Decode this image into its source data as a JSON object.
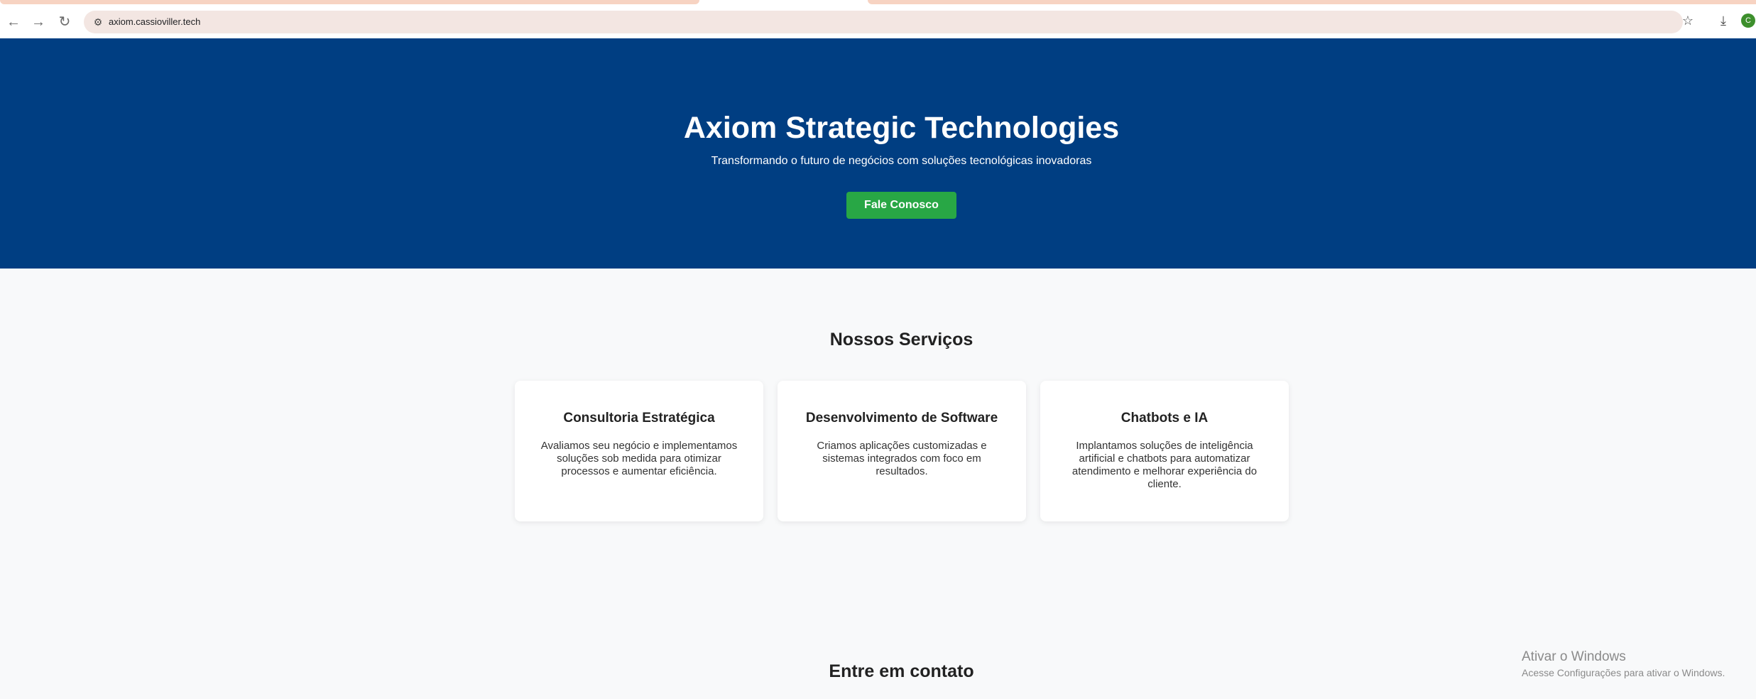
{
  "browser": {
    "url": "axiom.cassioviller.tech",
    "icons": {
      "back": "arrow-left-icon",
      "forward": "arrow-right-icon",
      "reload": "reload-icon",
      "site_info": "tune-icon",
      "bookmark": "star-icon",
      "download": "download-icon"
    },
    "avatar_initial": "C"
  },
  "hero": {
    "title": "Axiom Strategic Technologies",
    "subtitle": "Transformando o futuro de negócios com soluções tecnológicas inovadoras",
    "cta_label": "Fale Conosco",
    "background_color": "#003e82",
    "cta_color": "#28a745"
  },
  "services": {
    "title": "Nossos Serviços",
    "cards": [
      {
        "title": "Consultoria Estratégica",
        "text": "Avaliamos seu negócio e implementamos soluções sob medida para otimizar processos e aumentar eficiência."
      },
      {
        "title": "Desenvolvimento de Software",
        "text": "Criamos aplicações customizadas e sistemas integrados com foco em resultados."
      },
      {
        "title": "Chatbots e IA",
        "text": "Implantamos soluções de inteligência artificial e chatbots para automatizar atendimento e melhorar experiência do cliente."
      }
    ]
  },
  "contact": {
    "title": "Entre em contato"
  },
  "windows_watermark": {
    "title": "Ativar o Windows",
    "subtitle": "Acesse Configurações para ativar o Windows."
  }
}
